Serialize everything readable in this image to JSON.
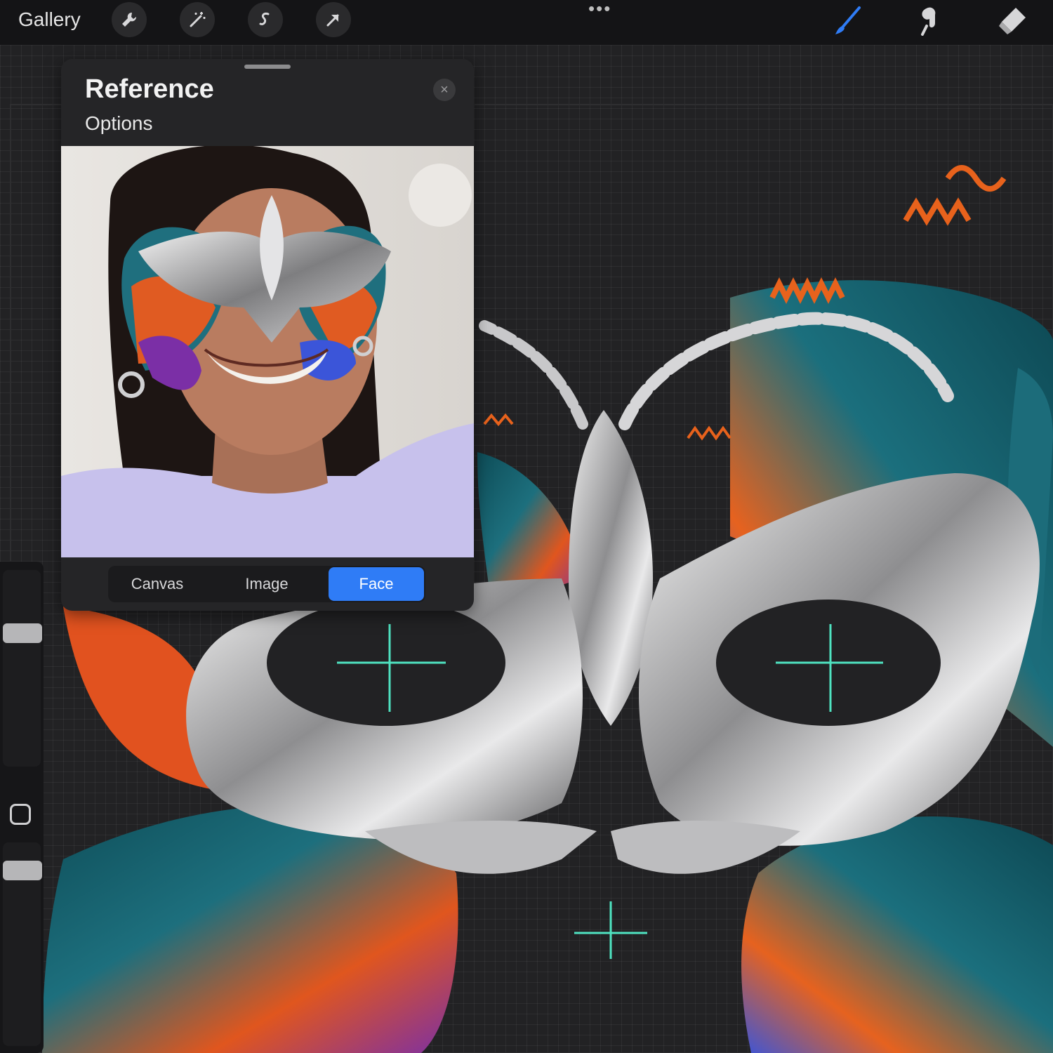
{
  "toolbar": {
    "gallery_label": "Gallery",
    "left_tools": [
      "wrench-icon",
      "magic-wand-icon",
      "selection-icon",
      "transform-arrow-icon"
    ],
    "right_tools": [
      "brush-icon",
      "smudge-icon",
      "eraser-icon"
    ],
    "active_tool": "brush-icon",
    "more_label": "•••"
  },
  "reference_panel": {
    "title": "Reference",
    "options_label": "Options",
    "close_label": "×",
    "tabs": [
      {
        "label": "Canvas",
        "active": false
      },
      {
        "label": "Image",
        "active": false
      },
      {
        "label": "Face",
        "active": true
      }
    ]
  },
  "sidebar": {
    "brush_size_level": 0.7,
    "opacity_level": 0.9
  },
  "colors": {
    "accent": "#2f7cf6",
    "guide": "#4fe3c1",
    "canvas_bg": "#222224"
  }
}
